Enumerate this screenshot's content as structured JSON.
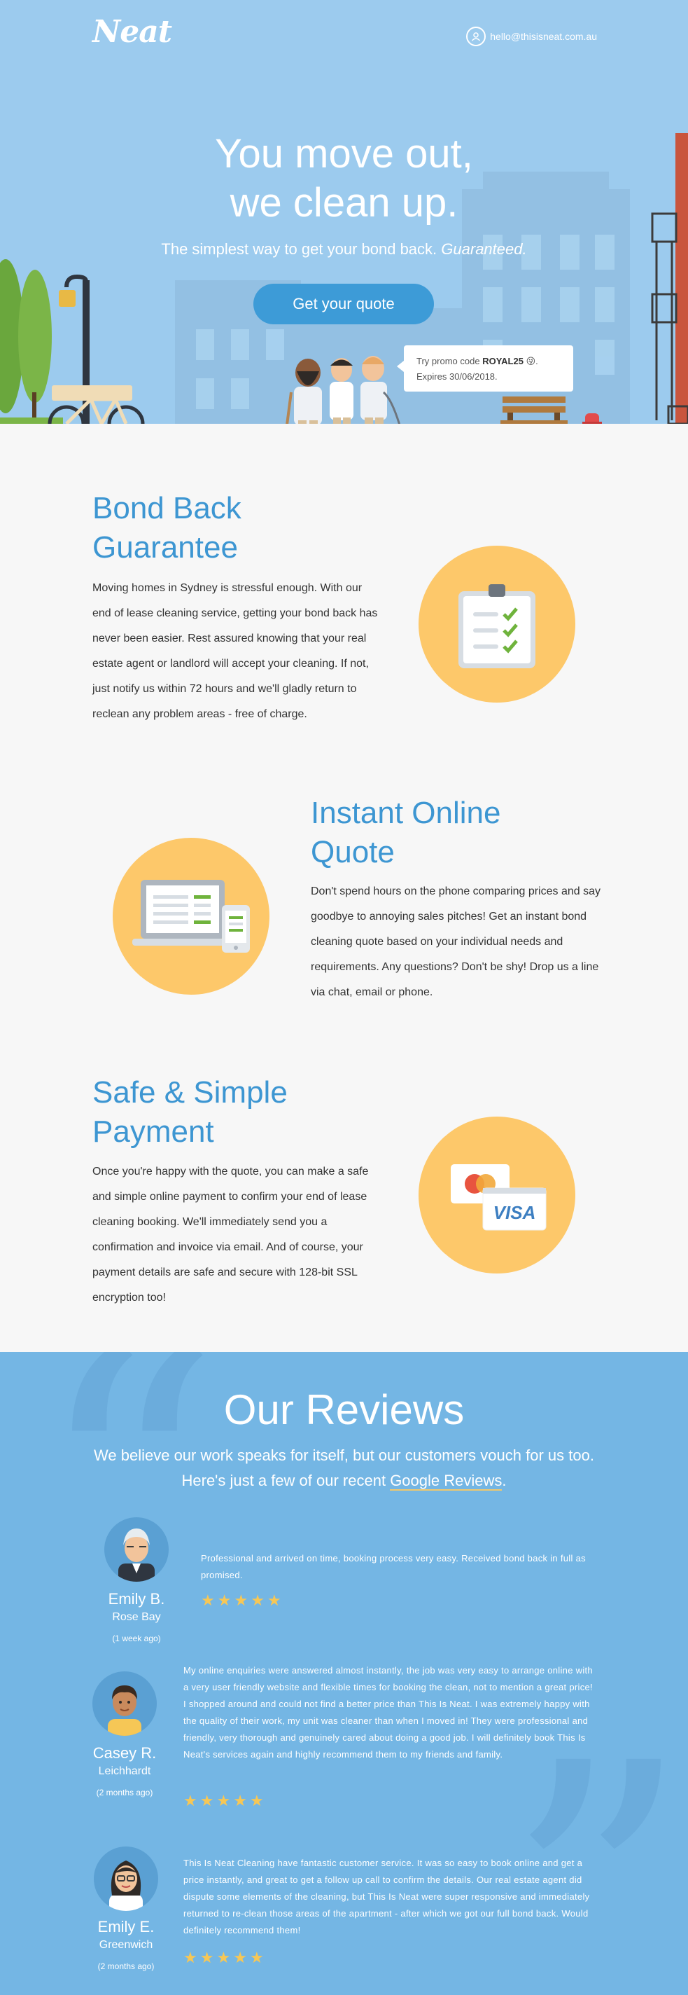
{
  "header": {
    "logo": "Neat",
    "email": "hello@thisisneat.com.au",
    "email_icon": "user-circle-icon"
  },
  "hero": {
    "title_line1": "You move out,",
    "title_line2": "we clean up.",
    "tagline": "The simplest way to get your bond back.",
    "tagline_em": "Guaranteed.",
    "cta_label": "Get your quote",
    "promo_prefix": "Try promo code",
    "promo_code": "ROYAL25",
    "promo_emoji": "😜",
    "promo_suffix": ".",
    "promo_expiry": "Expires 30/06/2018."
  },
  "features": [
    {
      "title": "Bond Back Guarantee",
      "text": "Moving homes in Sydney is stressful enough. With our end of lease cleaning service, getting your bond back has never been easier. Rest assured knowing that your real estate agent or landlord will accept your cleaning. If not, just notify us within 72 hours and we'll gladly return to reclean any problem areas - free of charge.",
      "icon": "clipboard-checklist-icon"
    },
    {
      "title": "Instant Online Quote",
      "text": "Don't spend hours on the phone comparing prices and say goodbye to annoying sales pitches! Get an instant bond cleaning quote based on your individual needs and requirements. Any questions? Don't be shy! Drop us a line via chat, email or phone.",
      "icon": "laptop-phone-icon"
    },
    {
      "title": "Safe & Simple Payment",
      "text": "Once you're happy with the quote, you can make a safe and simple online payment to confirm your end of lease cleaning booking. We'll immediately send you a confirmation and invoice via email. And of course, your payment details are safe and secure with 128-bit SSL encryption too!",
      "icon": "credit-cards-icon",
      "card_label": "VISA"
    }
  ],
  "reviews": {
    "title": "Our Reviews",
    "intro": "We believe our work speaks for itself, but our customers vouch for us too. Here's just a few of our recent",
    "intro_link": "Google Reviews",
    "intro_end": ".",
    "items": [
      {
        "name": "Emily B.",
        "suburb": "Rose Bay",
        "ago": "(1 week ago)",
        "rating": 5,
        "text": "Professional and arrived on time, booking process very easy. Received bond back in full as promised."
      },
      {
        "name": "Casey R.",
        "suburb": "Leichhardt",
        "ago": "(2 months ago)",
        "rating": 5,
        "text": "My online enquiries were answered almost instantly, the job was very easy to arrange online with a very user friendly website and flexible times for booking the clean, not to mention a great price! I shopped around and could not find a better price than This Is Neat. I was extremely happy with the quality of their work, my unit was cleaner than when I moved in! They were professional and friendly, very thorough and genuinely cared about doing a good job. I will definitely book This Is Neat's services again and highly recommend them to my friends and family."
      },
      {
        "name": "Emily E.",
        "suburb": "Greenwich",
        "ago": "(2 months ago)",
        "rating": 5,
        "text": "This Is Neat Cleaning have fantastic customer service. It was so easy to book online and get a price instantly, and great to get a follow up call to confirm the details. Our real estate agent did dispute some elements of the cleaning, but This Is Neat were super responsive and immediately returned to re-clean those areas of the apartment - after which we got our full bond back. Would definitely recommend them!"
      }
    ]
  },
  "colors": {
    "hero_bg": "#9ccbee",
    "accent_blue": "#3d96d2",
    "cta_blue": "#3d9bd7",
    "circle_yellow": "#fdc86a",
    "reviews_bg": "#74b6e4",
    "star": "#f6c756"
  }
}
